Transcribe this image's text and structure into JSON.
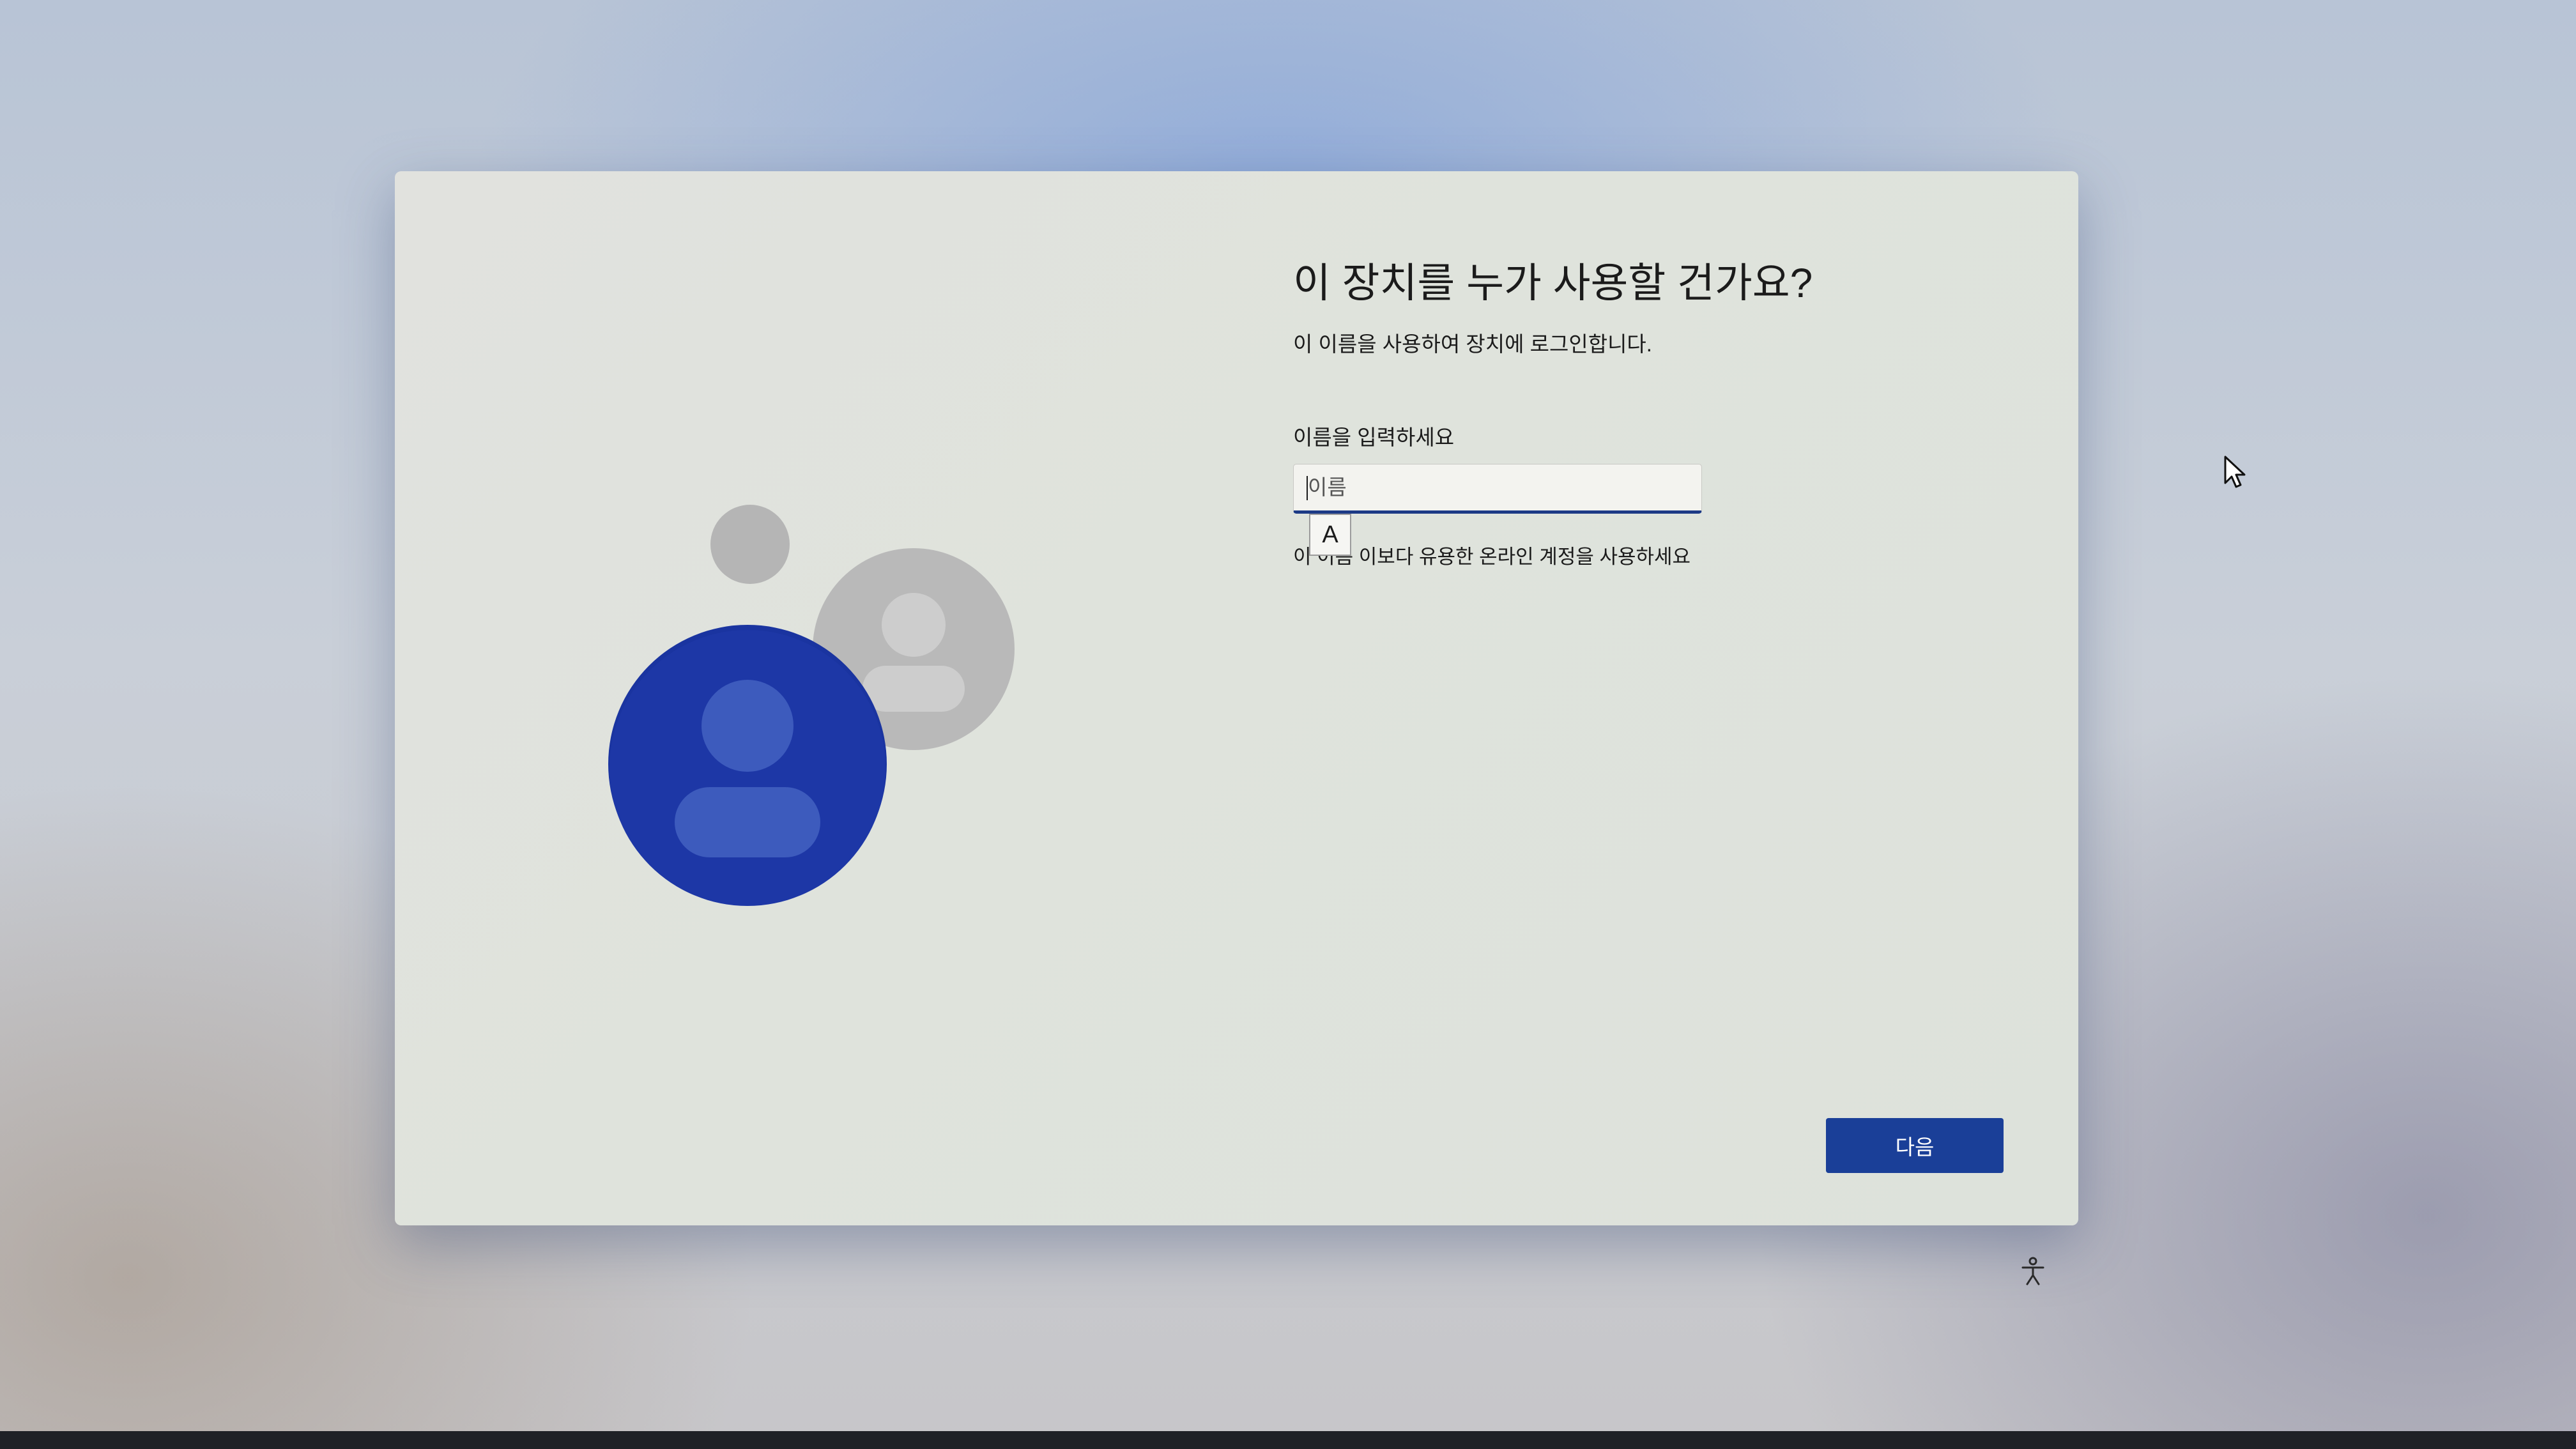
{
  "setup": {
    "title": "이 장치를 누가 사용할 건가요?",
    "subtitle": "이 이름을 사용하여 장치에 로그인합니다.",
    "name_label": "이름을 입력하세요",
    "name_placeholder": "이름",
    "name_value": "",
    "ime_indicator": "A",
    "online_account_link": "이 이름 이보다 유용한 온라인 계정을 사용하세요",
    "next_button": "다음"
  },
  "icons": {
    "illustration": "user-accounts-illustration",
    "accessibility": "accessibility-icon",
    "cursor": "mouse-pointer-icon"
  },
  "colors": {
    "accent": "#1a3f98",
    "primary_avatar": "#1a34a0",
    "secondary_avatar": "#b9b9b9",
    "window_background": "#e0e2dc"
  }
}
